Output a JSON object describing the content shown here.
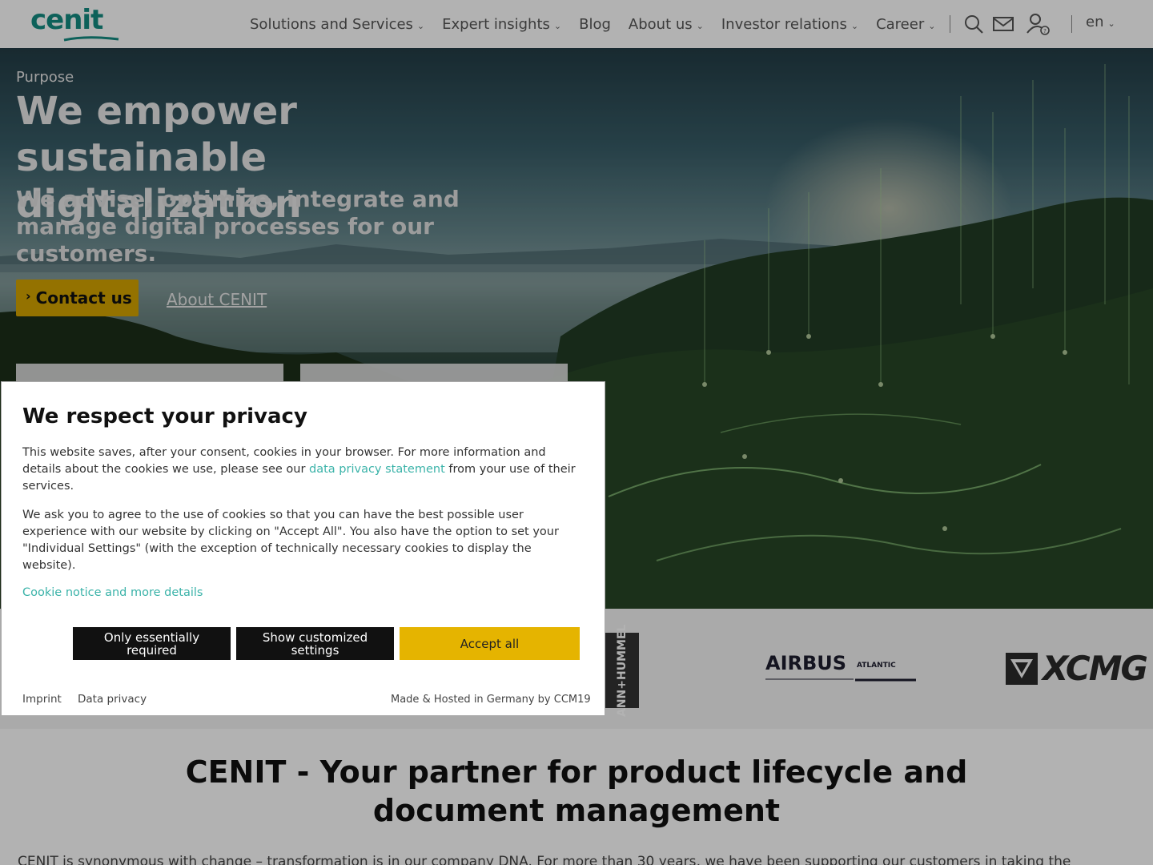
{
  "header": {
    "logo_text": "cenit",
    "nav": [
      {
        "label": "Solutions and Services",
        "has_dropdown": true
      },
      {
        "label": "Expert insights",
        "has_dropdown": true
      },
      {
        "label": "Blog",
        "has_dropdown": false
      },
      {
        "label": "About us",
        "has_dropdown": true
      },
      {
        "label": "Investor relations",
        "has_dropdown": true
      },
      {
        "label": "Career",
        "has_dropdown": true
      }
    ],
    "icons": [
      "search-icon",
      "mail-icon",
      "user-help-icon"
    ],
    "language": "en"
  },
  "hero": {
    "eyebrow": "Purpose",
    "title": "We empower sustainable digitalization",
    "subtitle": "We advise, optimize, integrate and manage digital processes for our customers.",
    "contact_button": "Contact us",
    "about_link": "About CENIT"
  },
  "logos": {
    "hummel": "ANN+HUMMEL",
    "airbus": "AIRBUS",
    "airbus_sub": "ATLANTIC",
    "xcmg": "XCMG"
  },
  "section": {
    "title": "CENIT - Your partner for product lifecycle and document management",
    "text": "CENIT is synonymous with change – transformation is in our company DNA. For more than 30 years, we have been supporting our customers in taking the"
  },
  "cookie_modal": {
    "title": "We respect your privacy",
    "p1_before": "This website saves, after your consent, cookies in your browser. For more information and details about the cookies we use, please see our ",
    "p1_link": "data privacy statement",
    "p1_after": " from your use of their services.",
    "p2": "We ask you to agree to the use of cookies so that you can have the best possible user experience with our website by clicking on \"Accept All\". You also have the option to set your \"Individual Settings\" (with the exception of technically necessary cookies to display the website).",
    "details_link": "Cookie notice and more details",
    "btn_essential": "Only essentially required",
    "btn_custom": "Show customized settings",
    "btn_accept": "Accept all",
    "footer_imprint": "Imprint",
    "footer_privacy": "Data privacy",
    "footer_made": "Made & Hosted in Germany by CCM19"
  },
  "colors": {
    "brand_teal": "#148c82",
    "accent_yellow": "#e5b400",
    "link_teal": "#3bb3a9"
  }
}
